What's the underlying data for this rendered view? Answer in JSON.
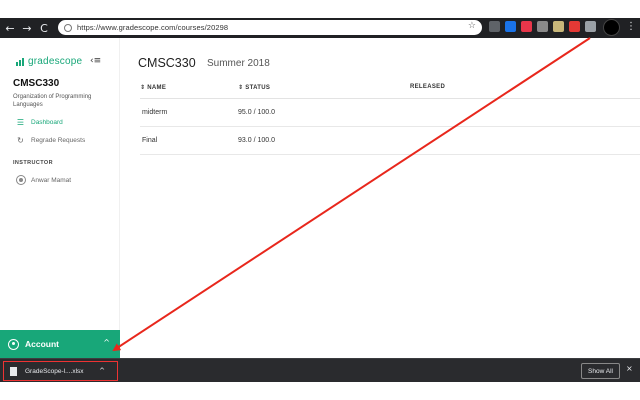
{
  "browser": {
    "url": "https://www.gradescope.com/courses/20298",
    "back_icon": "←",
    "forward_icon": "→",
    "reload_icon": "C",
    "star_icon": "☆",
    "menu_icon": "⋮",
    "extension_colors": [
      "#5f6368",
      "#1a73e8",
      "#e8364a",
      "#8a8a8a",
      "#c8b77a",
      "#e53935",
      "#9aa0a6"
    ]
  },
  "sidebar": {
    "logo_text": "gradescope",
    "collapse_icon": "‹≡",
    "course_code": "CMSC330",
    "course_name": "Organization of Programming Languages",
    "nav": [
      {
        "label": "Dashboard",
        "icon": "dashboard-icon",
        "glyph": "☰",
        "active": true
      },
      {
        "label": "Regrade Requests",
        "icon": "regrade-icon",
        "glyph": "↻",
        "active": false
      }
    ],
    "instructor_heading": "INSTRUCTOR",
    "instructor_name": "Anwar Mamat",
    "account_label": "Account",
    "account_caret": "^"
  },
  "main": {
    "title": "CMSC330",
    "term": "Summer 2018",
    "columns": [
      "⇕ NAME",
      "⇕ STATUS",
      "RELEASED"
    ],
    "rows": [
      {
        "name": "midterm",
        "status": "95.0 / 100.0",
        "released": ""
      },
      {
        "name": "Final",
        "status": "93.0 / 100.0",
        "released": ""
      }
    ]
  },
  "download_bar": {
    "file_name": "GradeScope-l....xlsx",
    "file_caret": "^",
    "show_all": "Show All",
    "close": "×"
  },
  "colors": {
    "brand": "#18a779",
    "annotation_arrow": "#e8271c"
  }
}
